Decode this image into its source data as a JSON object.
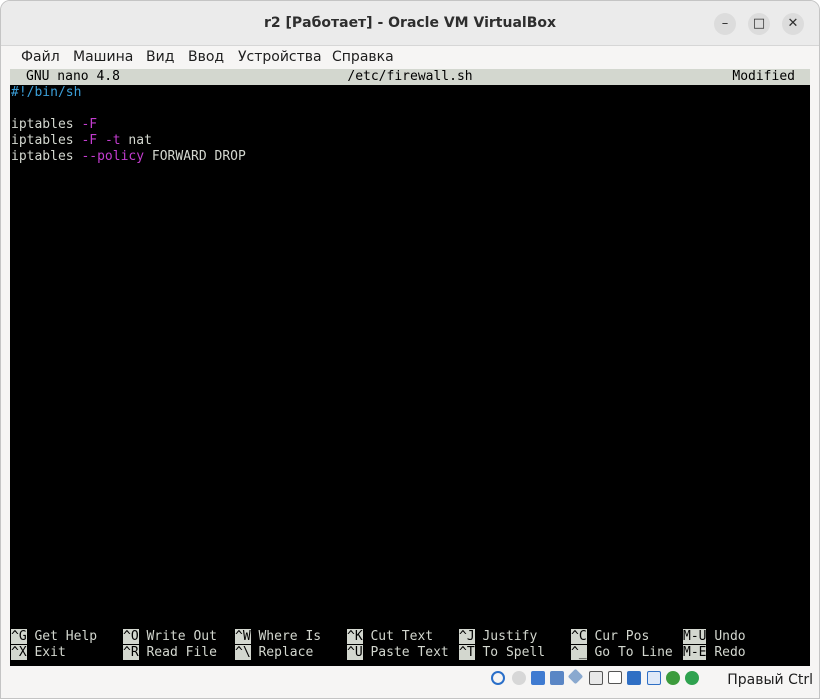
{
  "window": {
    "title": "r2 [Работает] - Oracle VM VirtualBox",
    "minimize": "–",
    "maximize": "□",
    "close": "✕"
  },
  "menu": [
    "Файл",
    "Машина",
    "Вид",
    "Ввод",
    "Устройства",
    "Справка"
  ],
  "nano": {
    "version": "GNU nano 4.8",
    "filename": "/etc/firewall.sh",
    "state": "Modified",
    "lines": [
      {
        "cmd": "#!/bin/sh"
      },
      {
        "cmd": "",
        "flags": [],
        "args": ""
      },
      {
        "cmd": "iptables ",
        "flags": [
          "-F"
        ],
        "args": ""
      },
      {
        "cmd": "iptables ",
        "flags": [
          "-F",
          "-t"
        ],
        "args": "nat"
      },
      {
        "cmd": "iptables ",
        "flags": [
          "--policy"
        ],
        "args": "FORWARD DROP"
      }
    ],
    "shortcuts": [
      [
        {
          "key": "^G",
          "label": "Get Help"
        },
        {
          "key": "^O",
          "label": "Write Out"
        },
        {
          "key": "^W",
          "label": "Where Is"
        },
        {
          "key": "^K",
          "label": "Cut Text"
        },
        {
          "key": "^J",
          "label": "Justify"
        },
        {
          "key": "^C",
          "label": "Cur Pos"
        },
        {
          "key": "M-U",
          "label": "Undo"
        }
      ],
      [
        {
          "key": "^X",
          "label": "Exit"
        },
        {
          "key": "^R",
          "label": "Read File"
        },
        {
          "key": "^\\",
          "label": "Replace"
        },
        {
          "key": "^U",
          "label": "Paste Text"
        },
        {
          "key": "^T",
          "label": "To Spell"
        },
        {
          "key": "^_",
          "label": "Go To Line"
        },
        {
          "key": "M-E",
          "label": "Redo"
        }
      ]
    ]
  },
  "statusbar": {
    "icons": [
      "hard-disk-icon",
      "optical-drive-icon",
      "audio-icon",
      "network-icon",
      "usb-icon",
      "shared-folders-icon",
      "display-icon",
      "recording-icon",
      "virtualization-icon",
      "cpu-icon",
      "mouse-integration-icon"
    ],
    "host_key": "Правый Ctrl"
  }
}
